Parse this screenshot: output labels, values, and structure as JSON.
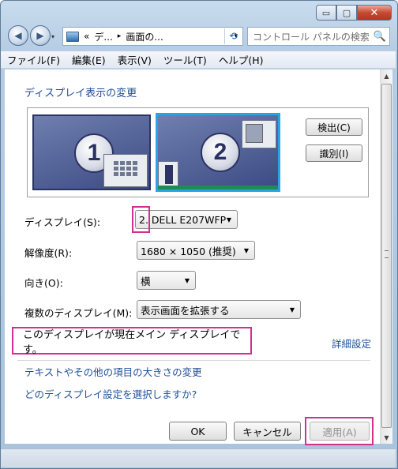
{
  "window": {
    "minimize_glyph": "▭",
    "maximize_glyph": "▢",
    "close_glyph": "✕"
  },
  "addressbar": {
    "chevron": "«",
    "crumb1": "デ...",
    "separator": "▸",
    "crumb2": "画面の...",
    "dropdown_glyph": "▾",
    "refresh_glyph": "⟲"
  },
  "search": {
    "placeholder": "コントロール パネルの検索",
    "icon": "🔍"
  },
  "menu": [
    "ファイル(F)",
    "編集(E)",
    "表示(V)",
    "ツール(T)",
    "ヘルプ(H)"
  ],
  "page": {
    "heading": "ディスプレイ表示の変更",
    "monitor1_number": "1",
    "monitor2_number": "2",
    "detect_button": "検出(C)",
    "identify_button": "識別(I)"
  },
  "settings": {
    "display_label": "ディスプレイ(S):",
    "display_value": "2. DELL E207WFP",
    "resolution_label": "解像度(R):",
    "resolution_value": "1680 × 1050 (推奨)",
    "orientation_label": "向き(O):",
    "orientation_value": "横",
    "multiple_label": "複数のディスプレイ(M):",
    "multiple_value": "表示画面を拡張する"
  },
  "info": {
    "main_display_text": "このディスプレイが現在メイン ディスプレイです。",
    "advanced_link": "詳細設定"
  },
  "links": {
    "text_size": "テキストやその他の項目の大きさの変更",
    "which_setting": "どのディスプレイ設定を選択しますか?"
  },
  "buttons": {
    "ok": "OK",
    "cancel": "キャンセル",
    "apply": "適用(A)"
  },
  "colors": {
    "link": "#1e4f9a",
    "highlight": "#d2308f",
    "selected_monitor_border": "#2aa3e4"
  }
}
